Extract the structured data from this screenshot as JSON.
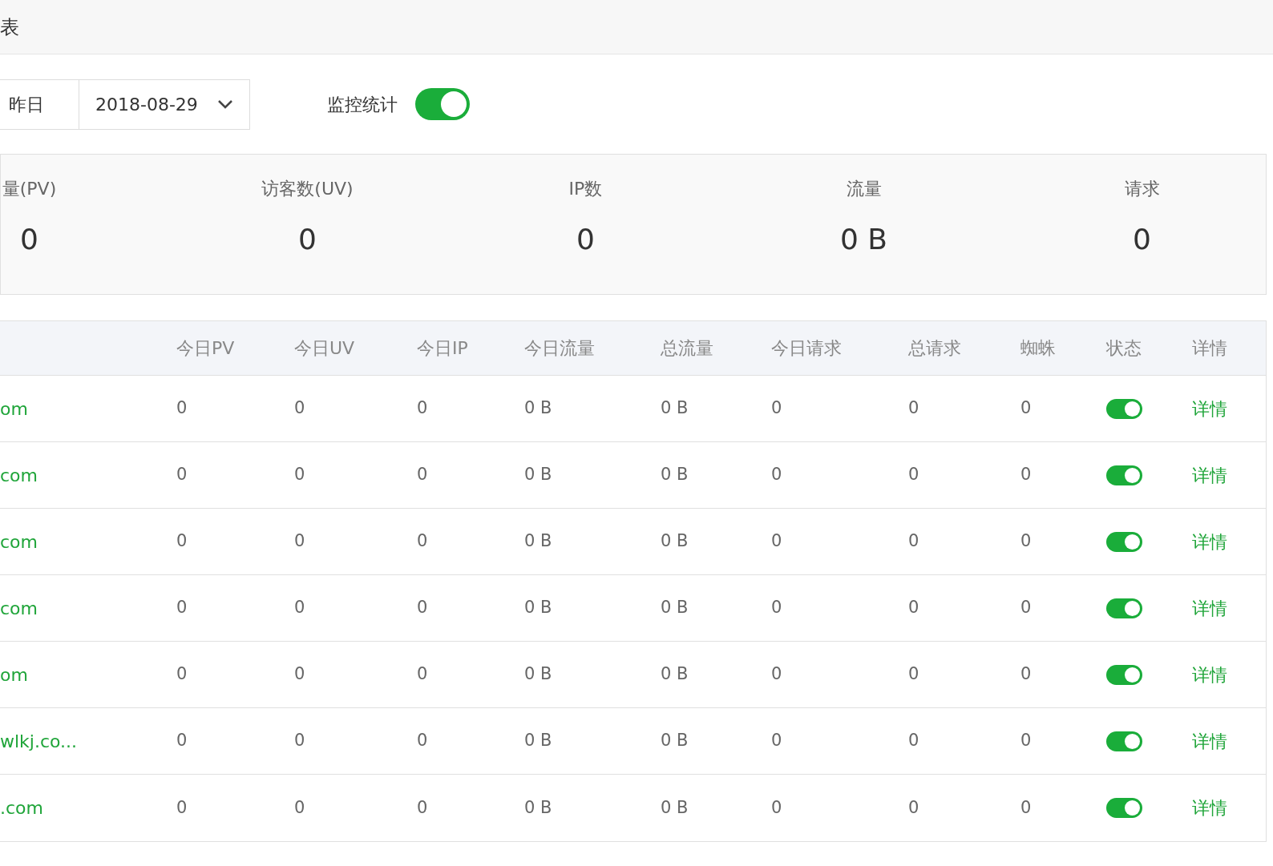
{
  "header": {
    "title": "表"
  },
  "filters": {
    "day_button": "昨日",
    "date": "2018-08-29",
    "monitor_label": "监控统计",
    "monitor_on": true
  },
  "stats": [
    {
      "label": "量(PV)",
      "value": "0"
    },
    {
      "label": "访客数(UV)",
      "value": "0"
    },
    {
      "label": "IP数",
      "value": "0"
    },
    {
      "label": "流量",
      "value": "0 B"
    },
    {
      "label": "请求",
      "value": "0"
    }
  ],
  "table": {
    "columns": [
      "今日PV",
      "今日UV",
      "今日IP",
      "今日流量",
      "总流量",
      "今日请求",
      "总请求",
      "蜘蛛",
      "状态",
      "详情"
    ],
    "rows": [
      {
        "domain": "om",
        "cells": [
          "0",
          "0",
          "0",
          "0 B",
          "0 B",
          "0",
          "0",
          "0"
        ],
        "status_on": true,
        "action": "详情"
      },
      {
        "domain": "com",
        "cells": [
          "0",
          "0",
          "0",
          "0 B",
          "0 B",
          "0",
          "0",
          "0"
        ],
        "status_on": true,
        "action": "详情"
      },
      {
        "domain": "com",
        "cells": [
          "0",
          "0",
          "0",
          "0 B",
          "0 B",
          "0",
          "0",
          "0"
        ],
        "status_on": true,
        "action": "详情"
      },
      {
        "domain": "com",
        "cells": [
          "0",
          "0",
          "0",
          "0 B",
          "0 B",
          "0",
          "0",
          "0"
        ],
        "status_on": true,
        "action": "详情"
      },
      {
        "domain": "om",
        "cells": [
          "0",
          "0",
          "0",
          "0 B",
          "0 B",
          "0",
          "0",
          "0"
        ],
        "status_on": true,
        "action": "详情"
      },
      {
        "domain": "wlkj.co...",
        "cells": [
          "0",
          "0",
          "0",
          "0 B",
          "0 B",
          "0",
          "0",
          "0"
        ],
        "status_on": true,
        "action": "详情"
      },
      {
        "domain": ".com",
        "cells": [
          "0",
          "0",
          "0",
          "0 B",
          "0 B",
          "0",
          "0",
          "0"
        ],
        "status_on": true,
        "action": "详情"
      }
    ]
  }
}
